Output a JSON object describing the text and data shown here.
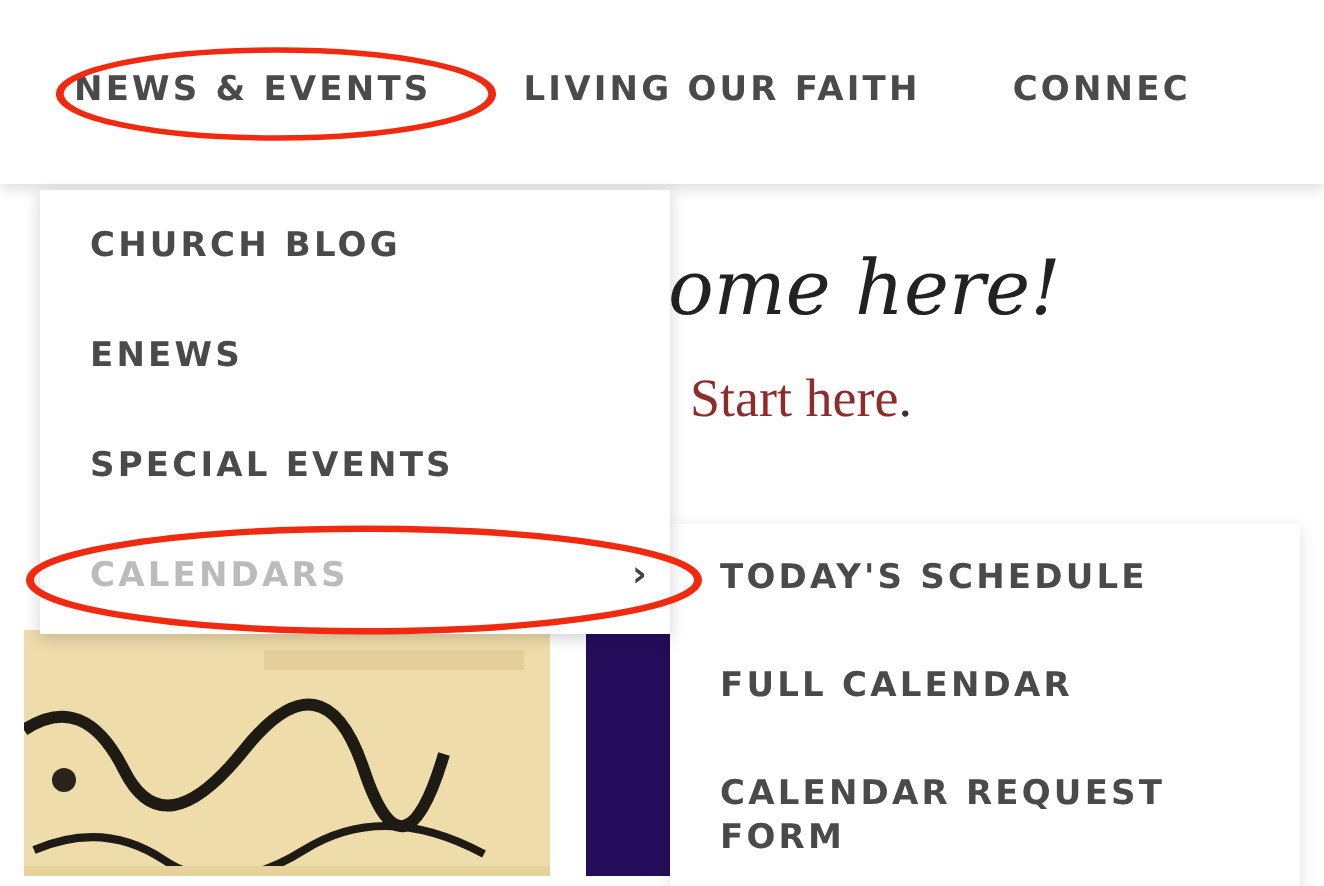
{
  "nav": {
    "items": [
      {
        "label": "NEWS & EVENTS",
        "highlighted": true
      },
      {
        "label": "LIVING OUR FAITH",
        "highlighted": false
      },
      {
        "label": "CONNEC",
        "highlighted": false
      }
    ]
  },
  "content": {
    "heading": "ome here!",
    "link": "Start here",
    "link_tail": "."
  },
  "dropdown": {
    "items": [
      {
        "label": "CHURCH BLOG",
        "selected": false,
        "highlighted": false
      },
      {
        "label": "ENEWS",
        "selected": false,
        "highlighted": false
      },
      {
        "label": "SPECIAL EVENTS",
        "selected": false,
        "highlighted": false
      },
      {
        "label": "CALENDARS",
        "selected": true,
        "highlighted": true,
        "arrow": "›"
      }
    ]
  },
  "submenu": {
    "items": [
      {
        "label": "TODAY'S SCHEDULE"
      },
      {
        "label": "FULL CALENDAR"
      },
      {
        "label": "CALENDAR REQUEST FORM"
      }
    ]
  },
  "cards": [
    {
      "kind": "picture"
    },
    {
      "kind": "banner"
    }
  ]
}
